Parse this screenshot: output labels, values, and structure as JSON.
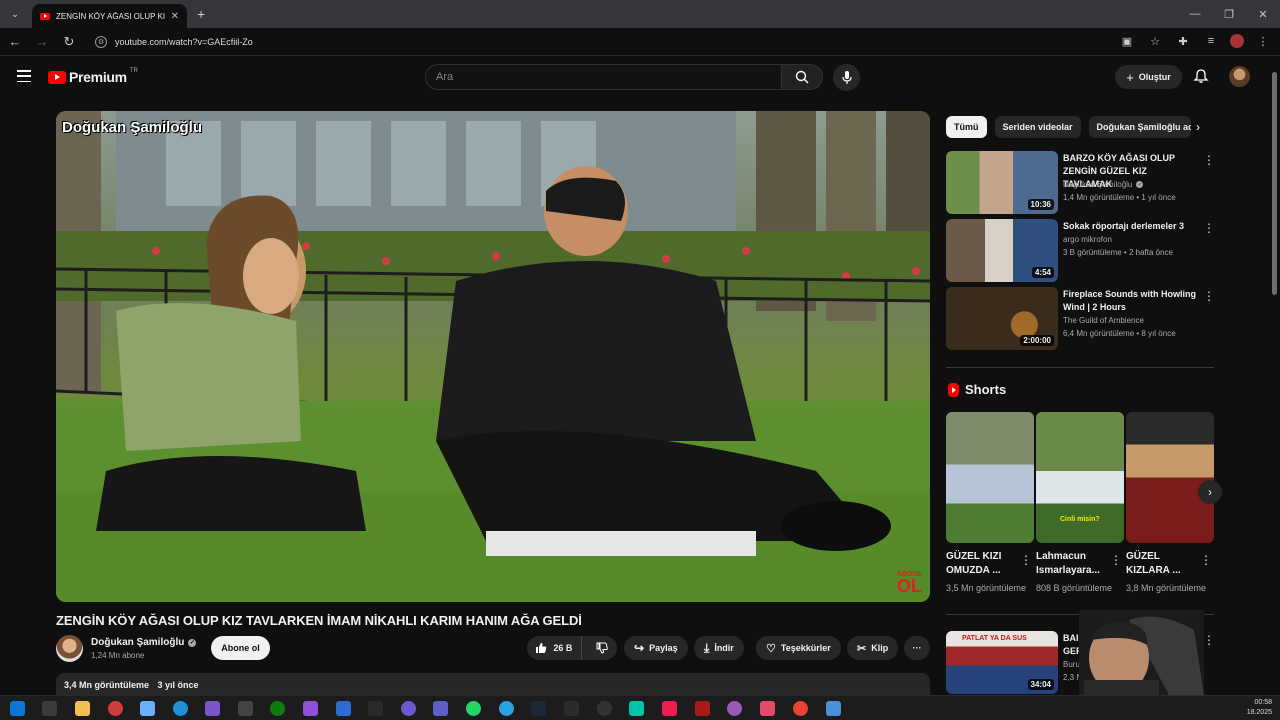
{
  "browser": {
    "tab_title": "ZENGİN KÖY AĞASI OLUP KIZ ...",
    "url": "youtube.com/watch?v=GAEcfiil-Zo"
  },
  "header": {
    "logo_text": "Premium",
    "logo_region": "TR",
    "search_placeholder": "Ara",
    "create_label": "Oluştur"
  },
  "video": {
    "watermark": "Doğukan Şamiloğlu",
    "corner_badge_top": "ABONE",
    "corner_badge_bottom": "OL",
    "title": "ZENGİN KÖY AĞASI OLUP KIZ TAVLARKEN İMAM NİKAHLI KARIM HANIM AĞA GELDİ",
    "channel": "Doğukan Şamiloğlu",
    "subscribers": "1,24 Mn abone",
    "subscribe_label": "Abone ol",
    "likes": "26 B",
    "share_label": "Paylaş",
    "download_label": "İndir",
    "thanks_label": "Teşekkürler",
    "clip_label": "Klip",
    "views": "3,4 Mn görüntüleme",
    "age": "3 yıl önce"
  },
  "sidebar": {
    "chips": [
      "Tümü",
      "Seriden videolar",
      "Doğukan Şamiloğlu ad"
    ],
    "recommendations": [
      {
        "title": "BARZO KÖY AĞASI OLUP ZENGİN GÜZEL KIZ TAVLAMAK",
        "channel": "Doğukan Şamiloğlu",
        "meta": "1,4 Mn görüntüleme • 1 yıl önce",
        "duration": "10:36"
      },
      {
        "title": "Sokak röportajı derlemeler 3",
        "channel": "argo mikrofon",
        "meta": "3 B görüntüleme • 2 hafta önce",
        "duration": "4:54"
      },
      {
        "title": "Fireplace Sounds with Howling Wind | 2 Hours",
        "channel": "The Guild of Ambience",
        "meta": "6,4 Mn görüntüleme • 8 yıl önce",
        "duration": "2:00:00"
      }
    ],
    "shorts_title": "Shorts",
    "shorts": [
      {
        "title": "GÜZEL KIZI OMUZDA ...",
        "views": "3,5 Mn görüntüleme"
      },
      {
        "title": "Lahmacun Ismarlayara...",
        "views": "808 B görüntüleme"
      },
      {
        "title": "GÜZEL KIZLARA ...",
        "views": "3,8 Mn görüntüleme"
      }
    ],
    "shorts_caption": "Cinli misin?",
    "next_rec": {
      "title": "BAI GEF",
      "channel": "Buru",
      "meta": "2,3 N",
      "duration": "34:04",
      "badge": "PATLAT YA DA SUS"
    }
  },
  "taskbar": {
    "time": "00:58",
    "date": "18.2025"
  }
}
